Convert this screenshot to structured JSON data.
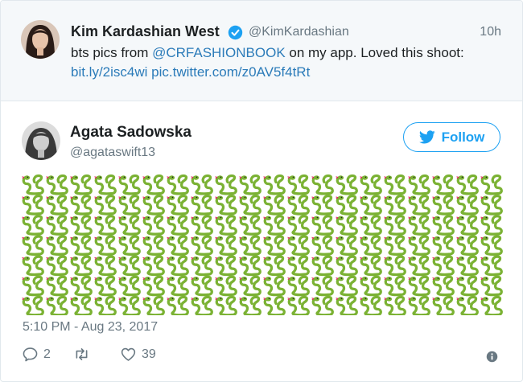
{
  "quoted_tweet": {
    "author_name": "Kim Kardashian West",
    "author_handle": "@KimKardashian",
    "time": "10h",
    "text_before": "bts pics from ",
    "mention": "@CRFASHIONBOOK",
    "text_after": " on my app. Loved this shoot:",
    "link1": "bit.ly/2isc4wi",
    "link2": "pic.twitter.com/z0AV5f4tRt"
  },
  "tweet": {
    "author_name": "Agata Sadowska",
    "author_handle": "@agataswift13",
    "follow_label": "Follow",
    "emoji_name": "snake",
    "emoji_rows": 7,
    "emoji_cols": 20,
    "timestamp": "5:10 PM - Aug 23, 2017",
    "reply_count": "2",
    "retweet_count": "",
    "like_count": "39"
  },
  "colors": {
    "brand": "#1da1f2",
    "link": "#2b7bb9",
    "muted": "#697882",
    "snake_green": "#7bb234"
  },
  "icons": [
    "verified-badge-icon",
    "twitter-bird-icon",
    "reply-icon",
    "retweet-icon",
    "like-icon",
    "info-icon",
    "snake-icon"
  ]
}
